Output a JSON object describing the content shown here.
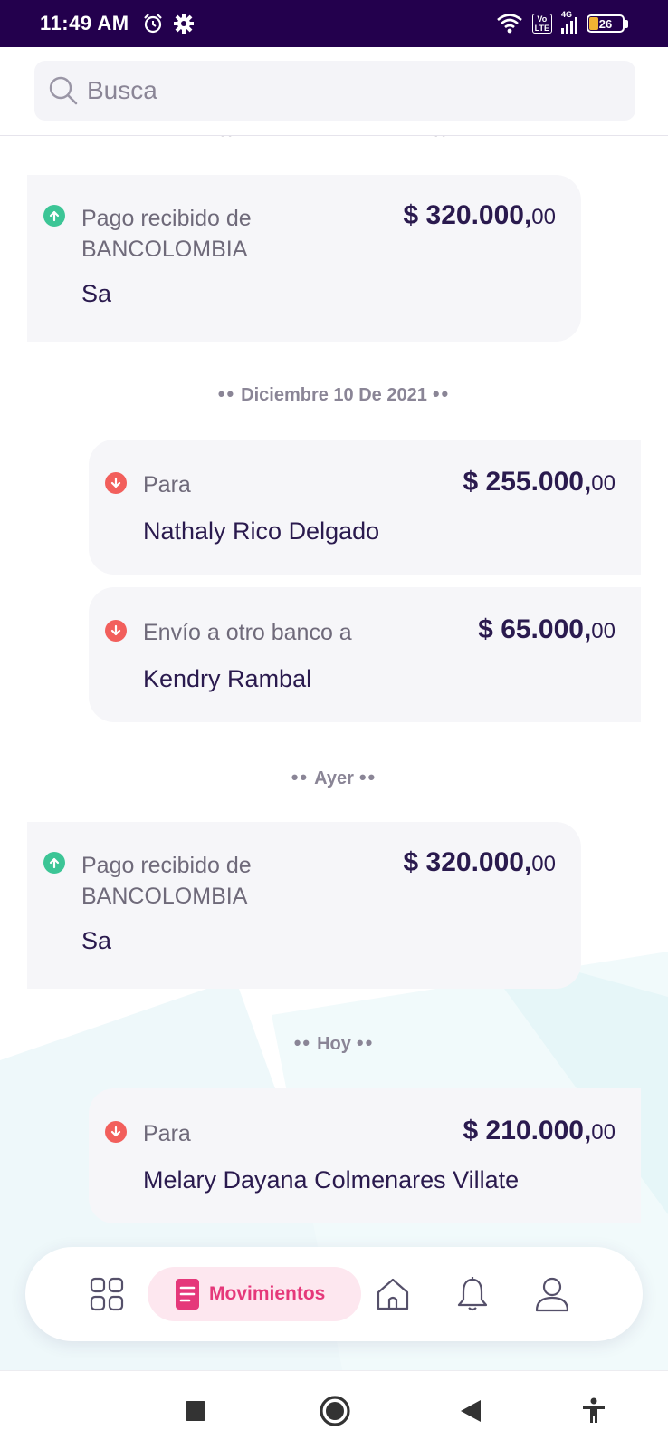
{
  "status_bar": {
    "time": "11:49 AM",
    "battery": "26",
    "network": "4G",
    "volte": "Vo\nLTE"
  },
  "search": {
    "placeholder": "Busca"
  },
  "transactions": [
    {
      "direction": "in",
      "label_line1": "Pago recibido de",
      "label_line2": "BANCOLOMBIA",
      "name": "Sa",
      "amount": "$ 320.000,",
      "cents": "00"
    },
    {
      "date_header": "Diciembre 10 De 2021"
    },
    {
      "direction": "out",
      "label_line1": "Para",
      "name": "Nathaly Rico Delgado",
      "amount": "$ 255.000,",
      "cents": "00"
    },
    {
      "direction": "out",
      "label_line1": "Envío a otro banco a",
      "name": "Kendry Rambal",
      "amount": "$ 65.000,",
      "cents": "00"
    },
    {
      "date_header": "Ayer"
    },
    {
      "direction": "in",
      "label_line1": "Pago recibido de",
      "label_line2": "BANCOLOMBIA",
      "name": "Sa",
      "amount": "$ 320.000,",
      "cents": "00"
    },
    {
      "date_header": "Hoy"
    },
    {
      "direction": "out",
      "label_line1": "Para",
      "name": "Melary Dayana Colmenares Villate",
      "amount": "$ 210.000,",
      "cents": "00"
    }
  ],
  "bottom_nav": {
    "items": [
      {
        "icon": "grid-icon"
      },
      {
        "icon": "list-icon",
        "label": "Movimientos",
        "active": true
      },
      {
        "icon": "home-icon"
      },
      {
        "icon": "bell-icon"
      },
      {
        "icon": "user-icon"
      }
    ]
  },
  "colors": {
    "status_bar": "#23004d",
    "primary_text": "#2a1a4e",
    "incoming": "#3cc596",
    "outgoing": "#f25f5c",
    "accent": "#e5387a",
    "accent_bg": "#fde7ef"
  }
}
